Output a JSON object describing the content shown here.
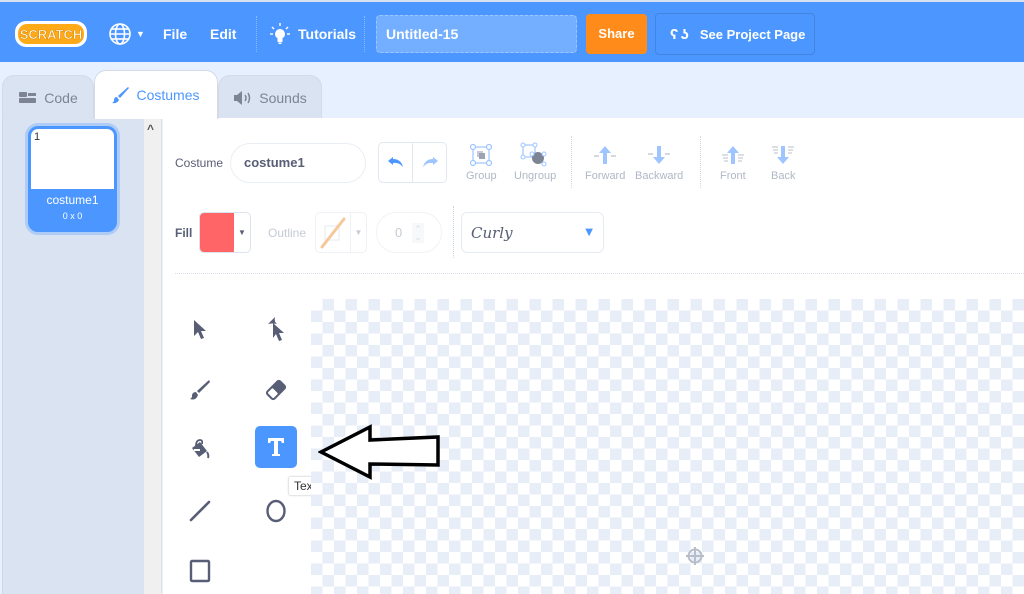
{
  "menubar": {
    "logo_text": "SCRATCH",
    "language_icon": "globe-icon",
    "file_label": "File",
    "edit_label": "Edit",
    "tutorials_label": "Tutorials",
    "project_title": "Untitled-15",
    "share_label": "Share",
    "see_project_label": "See Project Page",
    "colors": {
      "bar": "#4c97ff",
      "share": "#ff8c1a"
    }
  },
  "tabs": [
    {
      "label": "Code",
      "icon": "code-blocks-icon",
      "active": false
    },
    {
      "label": "Costumes",
      "icon": "brush-icon",
      "active": true
    },
    {
      "label": "Sounds",
      "icon": "speaker-icon",
      "active": false
    }
  ],
  "sidebar": {
    "costumes": [
      {
        "number": "1",
        "name": "costume1",
        "size": "0 x 0",
        "selected": true
      }
    ]
  },
  "editor": {
    "costume_label": "Costume",
    "costume_name": "costume1",
    "undo_icon": "undo-icon",
    "redo_icon": "redo-icon",
    "actions": [
      {
        "label": "Group",
        "icon": "group-icon"
      },
      {
        "label": "Ungroup",
        "icon": "ungroup-icon"
      },
      {
        "label": "Forward",
        "icon": "forward-icon"
      },
      {
        "label": "Backward",
        "icon": "backward-icon"
      },
      {
        "label": "Front",
        "icon": "front-icon"
      },
      {
        "label": "Back",
        "icon": "back-icon"
      }
    ],
    "fill_label": "Fill",
    "fill_color": "#ff6466",
    "outline_label": "Outline",
    "outline_width": "0",
    "font": "Curly",
    "tools": [
      {
        "name": "select",
        "icon": "select-arrow-icon"
      },
      {
        "name": "reshape",
        "icon": "reshape-icon"
      },
      {
        "name": "brush",
        "icon": "brush-icon"
      },
      {
        "name": "eraser",
        "icon": "eraser-icon"
      },
      {
        "name": "fill",
        "icon": "fill-bucket-icon"
      },
      {
        "name": "text",
        "icon": "text-icon",
        "active": true
      },
      {
        "name": "line",
        "icon": "line-icon"
      },
      {
        "name": "circle",
        "icon": "circle-icon"
      },
      {
        "name": "rectangle",
        "icon": "rectangle-icon"
      }
    ],
    "tooltip": "Text"
  }
}
